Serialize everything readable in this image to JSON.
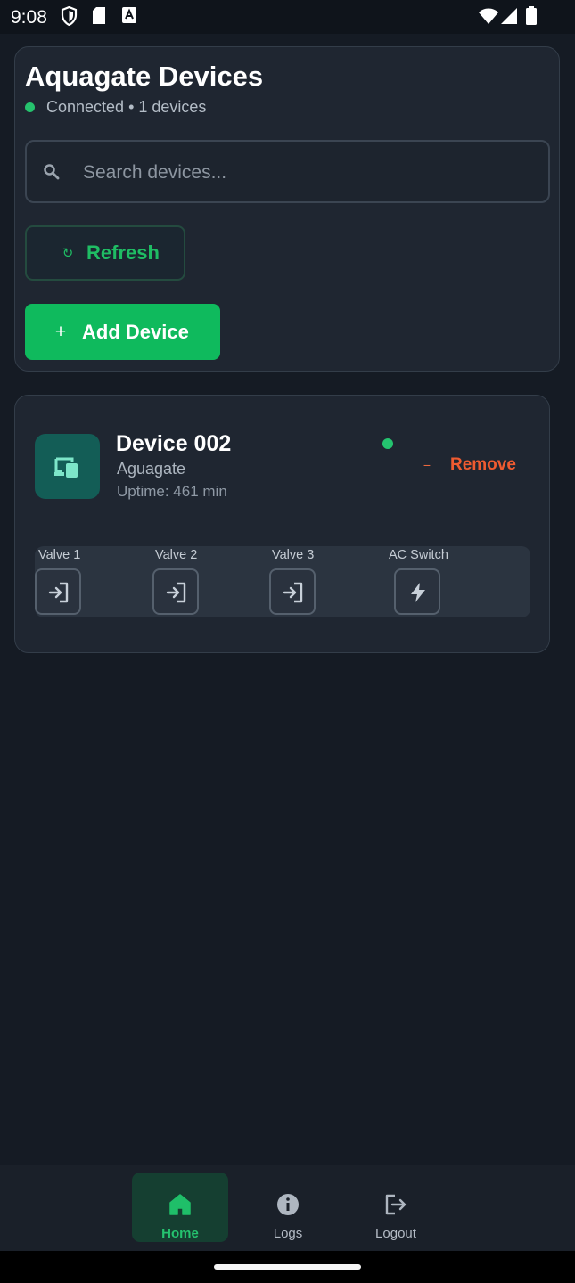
{
  "status_bar": {
    "time": "9:08",
    "left_icons": [
      "shield-icon",
      "sd-card-icon",
      "a-icon"
    ],
    "right_icons": [
      "wifi-icon",
      "signal-icon",
      "battery-icon"
    ]
  },
  "header": {
    "title": "Aquagate Devices",
    "connection_status": "Connected • 1 devices"
  },
  "search": {
    "placeholder": "Search devices..."
  },
  "actions": {
    "refresh_label": "Refresh",
    "refresh_icon": "↻",
    "add_label": "Add Device",
    "add_icon": "+"
  },
  "devices": [
    {
      "name": "Device 002",
      "type": "Aguagate",
      "uptime": "Uptime: 461 min",
      "remove_label": "Remove",
      "remove_icon": "−",
      "controls": [
        {
          "label": "Valve 1",
          "icon": "login-arrow-icon"
        },
        {
          "label": "Valve 2",
          "icon": "login-arrow-icon"
        },
        {
          "label": "Valve 3",
          "icon": "login-arrow-icon"
        },
        {
          "label": "AC Switch",
          "icon": "lightning-icon"
        }
      ]
    }
  ],
  "bottom_nav": [
    {
      "label": "Home",
      "icon": "home-icon",
      "active": true
    },
    {
      "label": "Logs",
      "icon": "info-icon",
      "active": false
    },
    {
      "label": "Logout",
      "icon": "logout-icon",
      "active": false
    }
  ],
  "colors": {
    "accent": "#0fba5d",
    "danger": "#ef5b30",
    "background": "#151b24",
    "card": "#1f2631"
  }
}
